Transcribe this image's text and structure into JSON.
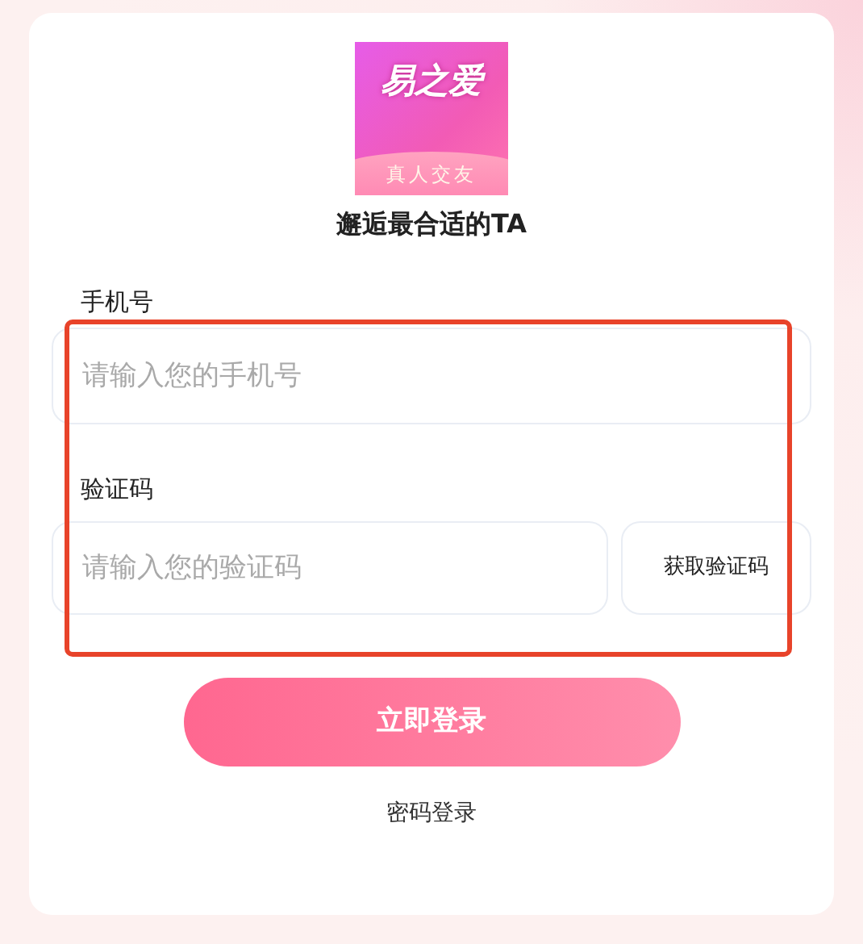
{
  "logo": {
    "name": "易之爱",
    "tagline": "真人交友"
  },
  "slogan": "邂逅最合适的TA",
  "phone": {
    "label": "手机号",
    "placeholder": "请输入您的手机号"
  },
  "code": {
    "label": "验证码",
    "placeholder": "请输入您的验证码",
    "button": "获取验证码"
  },
  "login_button": "立即登录",
  "alt_login": "密码登录"
}
